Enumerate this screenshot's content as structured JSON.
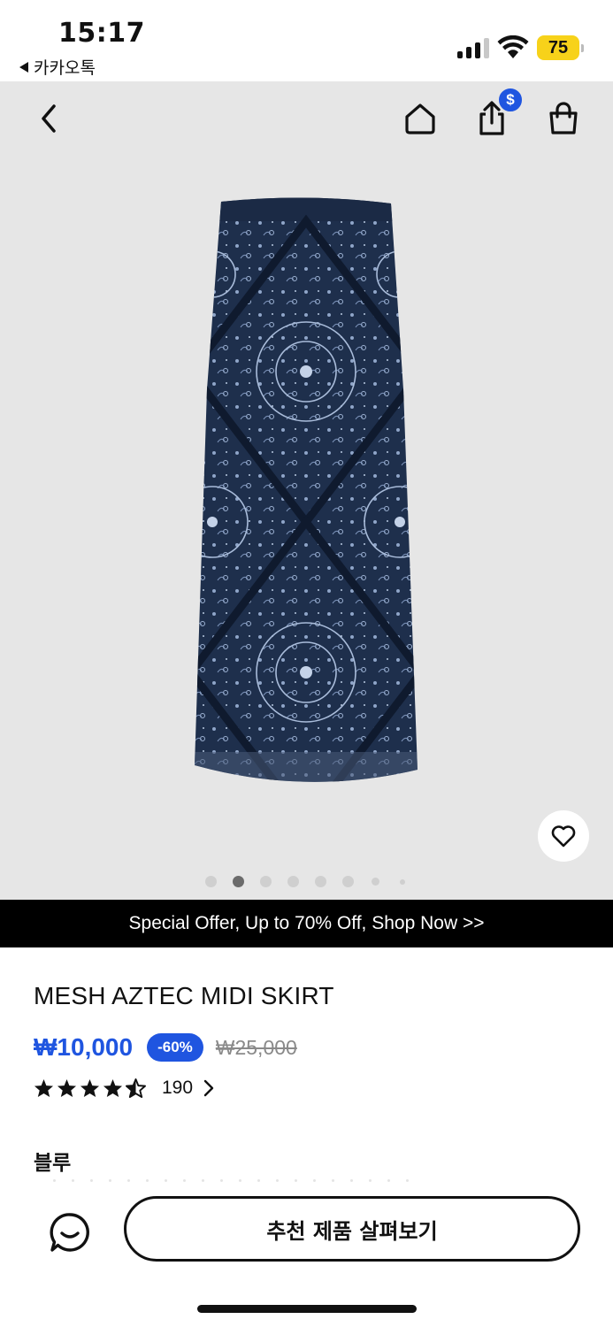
{
  "status_bar": {
    "time": "15:17",
    "back_app": "카카오톡",
    "battery": "75"
  },
  "hero": {
    "share_badge": "$",
    "carousel": {
      "total": 8,
      "active_index": 1
    },
    "image": "skirt-product-photo"
  },
  "promo_banner": "Special Offer, Up to 70% Off, Shop Now >>",
  "product": {
    "title": "MESH AZTEC MIDI SKIRT",
    "price": "₩10,000",
    "discount": "-60%",
    "original_price": "₩25,000",
    "rating": 4.5,
    "review_count": "190",
    "color_label": "블루"
  },
  "bottom_bar": {
    "cta_label": "추천 제품 살펴보기"
  },
  "colors": {
    "accent_blue": "#1f55e0",
    "battery_yellow": "#f7d21a",
    "hero_bg": "#e6e6e6",
    "banner_bg": "#000000"
  },
  "icons": [
    "chevron-left-icon",
    "home-icon",
    "share-icon",
    "shopping-bag-icon",
    "heart-icon",
    "star-icon",
    "chevron-right-icon",
    "chat-bubble-icon"
  ]
}
